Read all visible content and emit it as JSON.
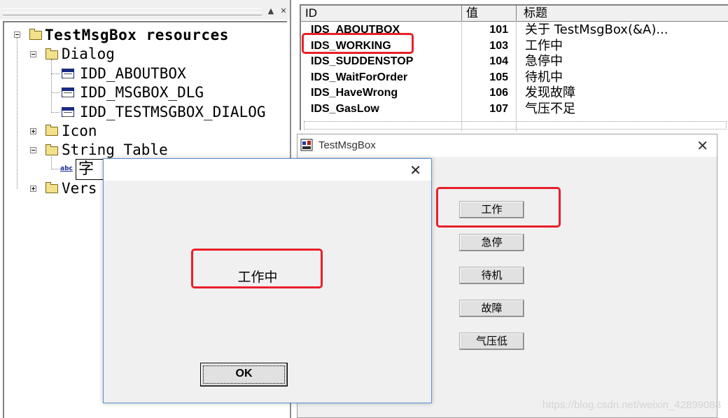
{
  "tree": {
    "root_label": "TestMsgBox resources",
    "dialog_folder": "Dialog",
    "dialog_items": [
      "IDD_ABOUTBOX",
      "IDD_MSGBOX_DLG",
      "IDD_TESTMSGBOX_DIALOG"
    ],
    "icon_folder": "Icon",
    "string_table_folder": "String Table",
    "string_table_item": "字",
    "version_folder": "Vers",
    "pane_buttons": [
      "▲",
      "✕"
    ]
  },
  "string_table": {
    "headers": {
      "id": "ID",
      "value": "值",
      "caption": "标题"
    },
    "rows": [
      {
        "id": "IDS_ABOUTBOX",
        "value": "101",
        "caption": "关于 TestMsgBox(&A)..."
      },
      {
        "id": "IDS_WORKING",
        "value": "103",
        "caption": "工作中"
      },
      {
        "id": "IDS_SUDDENSTOP",
        "value": "104",
        "caption": "急停中"
      },
      {
        "id": "IDS_WaitForOrder",
        "value": "105",
        "caption": "待机中"
      },
      {
        "id": "IDS_HaveWrong",
        "value": "106",
        "caption": "发现故障"
      },
      {
        "id": "IDS_GasLow",
        "value": "107",
        "caption": "气压不足"
      }
    ]
  },
  "main_dialog": {
    "title": "TestMsgBox",
    "close_glyph": "✕",
    "buttons": [
      "工作",
      "急停",
      "待机",
      "故障",
      "气压低"
    ]
  },
  "message_box": {
    "close_glyph": "✕",
    "message": "工作中",
    "ok_label": "OK"
  },
  "watermark": "https://blog.csdn.net/weixin_42899088",
  "colors": {
    "highlight_red": "#e8202a",
    "dialog_bg": "#f0f0f0"
  }
}
